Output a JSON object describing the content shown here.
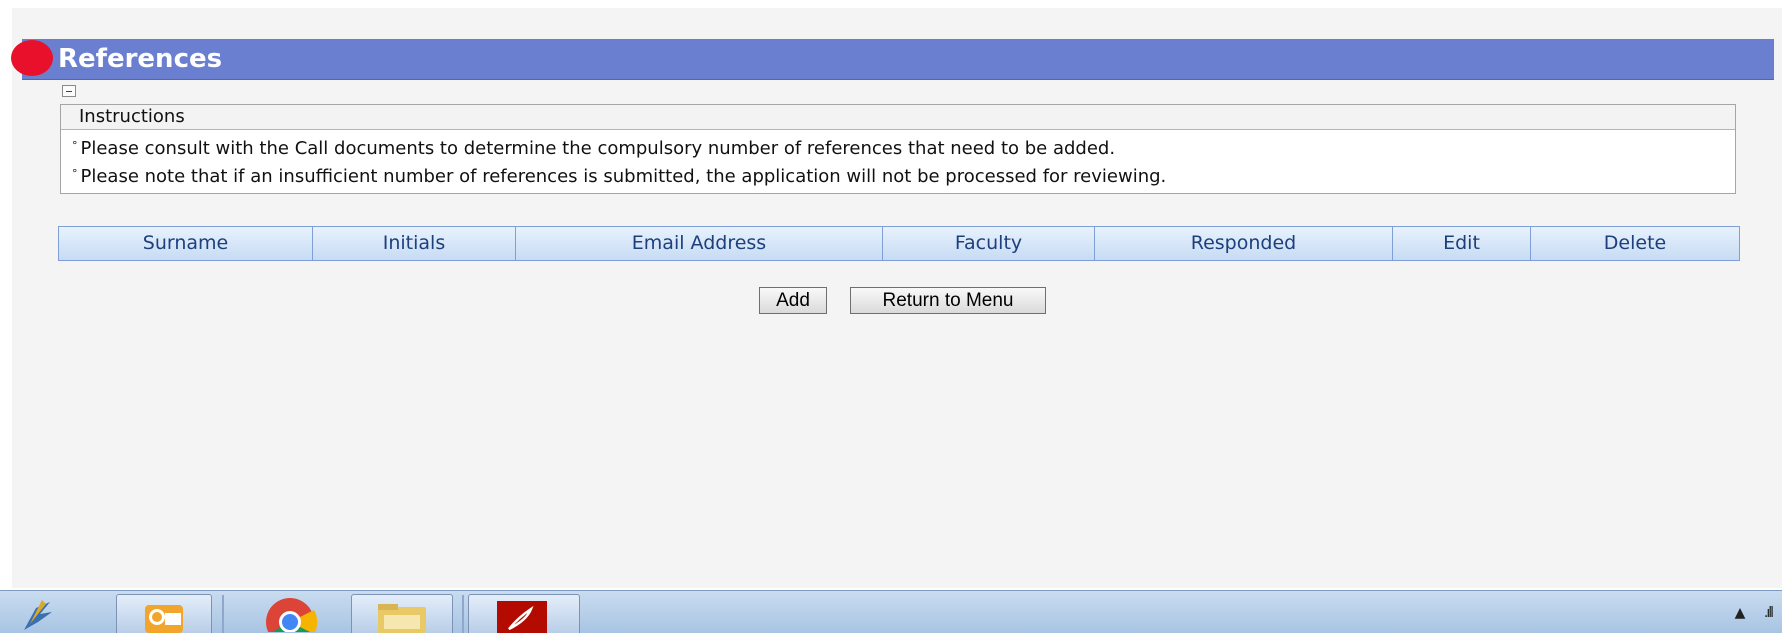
{
  "header": {
    "title": "References"
  },
  "instructions": {
    "heading": "Instructions",
    "bullet": "°",
    "lines": [
      "Please consult with the Call documents to determine the compulsory number of references that need to be added.",
      "Please note that if an insufficient number of references is submitted, the application will not be processed for reviewing."
    ]
  },
  "table": {
    "columns": [
      "Surname",
      "Initials",
      "Email Address",
      "Faculty",
      "Responded",
      "Edit",
      "Delete"
    ]
  },
  "buttons": {
    "add_label": "Add",
    "return_label": "Return to Menu"
  },
  "taskbar": {
    "items": [
      "bird-app-icon",
      "outlook-icon",
      "chrome-icon",
      "folder-icon",
      "acrobat-icon"
    ],
    "tray_icons": [
      "tray-expand-icon",
      "signal-icon"
    ]
  },
  "colors": {
    "header": "#6b7fd0",
    "header_dot": "#e8102a",
    "grid_text": "#1d3f7d"
  }
}
